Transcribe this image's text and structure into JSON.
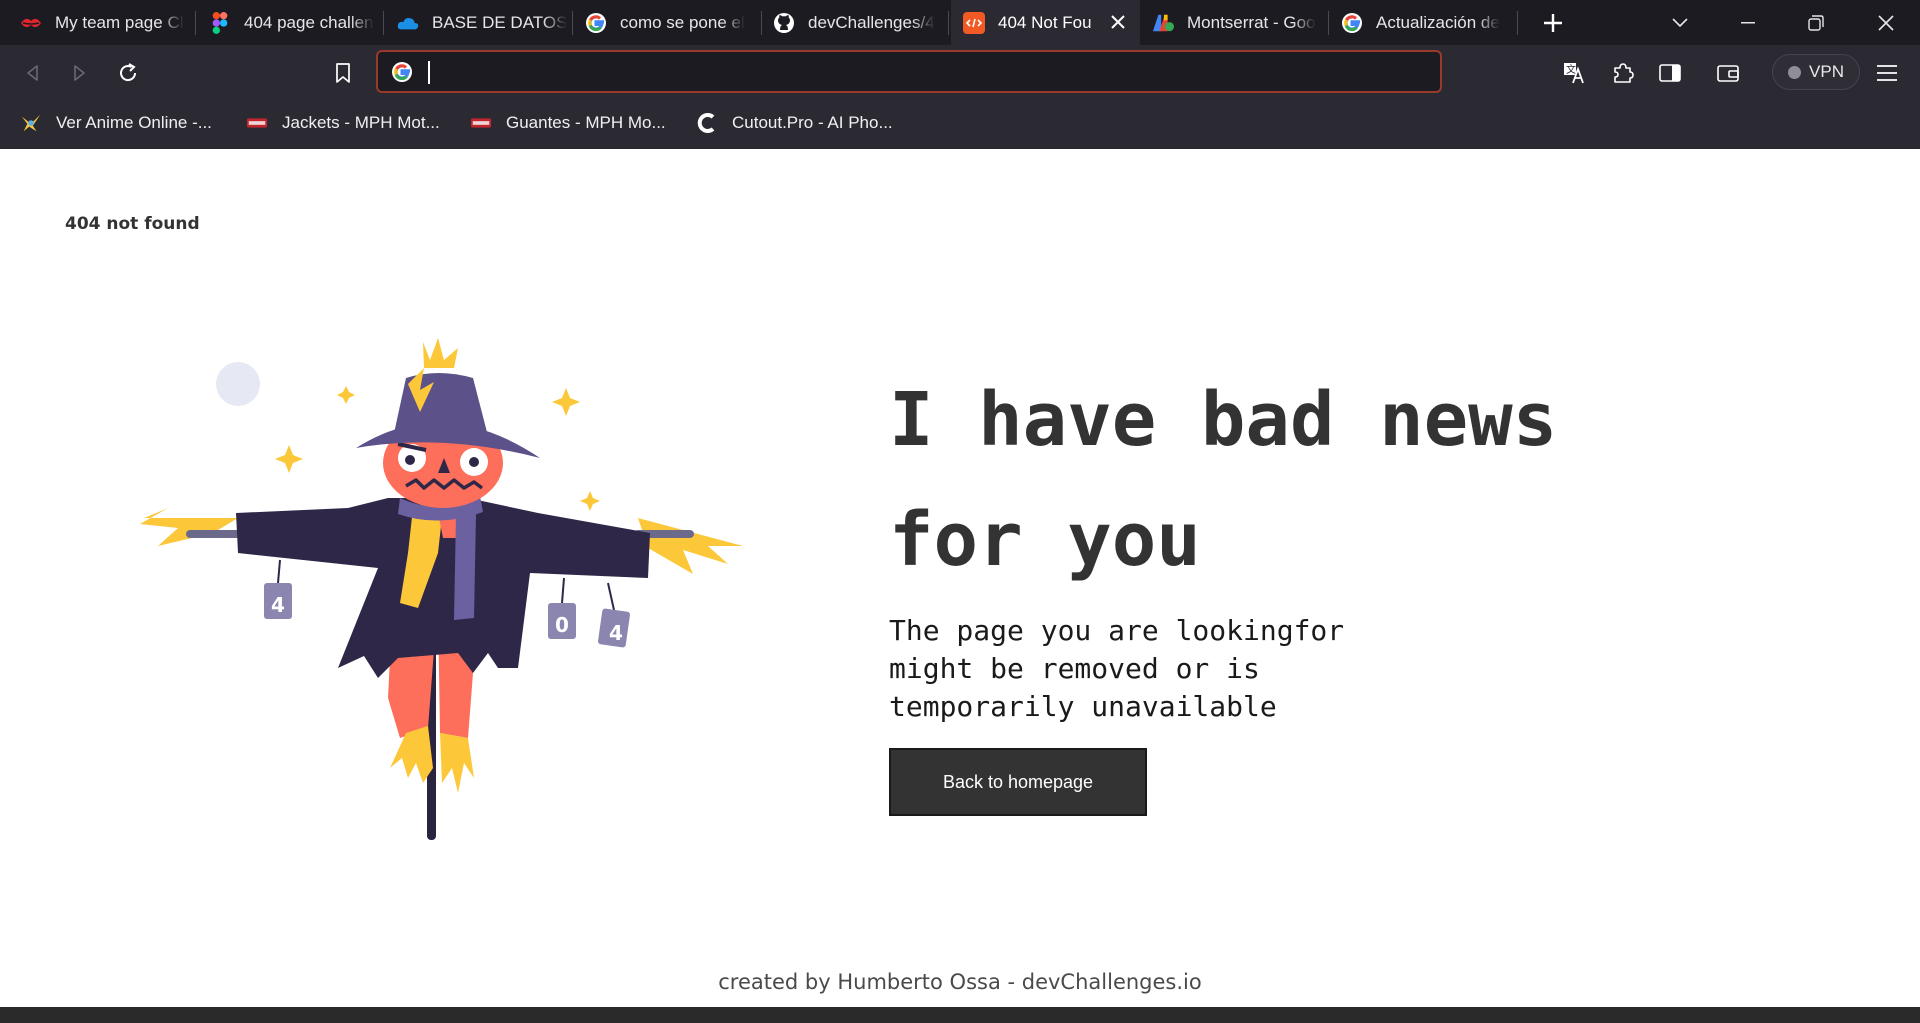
{
  "browser": {
    "tabs": [
      {
        "title": "My team page Cl",
        "icon": "lips-icon",
        "active": false
      },
      {
        "title": "404 page challen",
        "icon": "figma-icon",
        "active": false
      },
      {
        "title": "BASE DE DATOS",
        "icon": "onedrive-icon",
        "active": false
      },
      {
        "title": "como se pone el",
        "icon": "google-icon",
        "active": false
      },
      {
        "title": "devChallenges/4",
        "icon": "github-icon",
        "active": false
      },
      {
        "title": "404 Not Fou",
        "icon": "codepen-icon",
        "active": true
      },
      {
        "title": "Montserrat - Goo",
        "icon": "fonts-icon",
        "active": false
      },
      {
        "title": "Actualización de",
        "icon": "google-icon",
        "active": false
      }
    ],
    "address_value": "",
    "vpn_label": "VPN",
    "bookmarks": [
      {
        "label": "Ver Anime Online -...",
        "icon": "anime-icon"
      },
      {
        "label": "Jackets - MPH Mot...",
        "icon": "mph-icon"
      },
      {
        "label": "Guantes - MPH Mo...",
        "icon": "mph-icon"
      },
      {
        "label": "Cutout.Pro - AI Pho...",
        "icon": "cutout-icon"
      }
    ]
  },
  "page": {
    "brand": "404 not found",
    "headline": "I have bad news for you",
    "subtext": "The page you are lookingfor might be removed or is temporarily unavailable",
    "button_label": "Back to homepage",
    "footer": "created by Humberto Ossa - devChallenges.io",
    "illustration": {
      "can_labels": [
        "4",
        "0",
        "4"
      ]
    }
  },
  "colors": {
    "chrome_dark": "#1c1b22",
    "chrome": "#2b2a33",
    "text_dark": "#333333",
    "coat": "#2f2748",
    "hat": "#5c5189",
    "skin": "#fd6f5a",
    "straw": "#fcc83a"
  }
}
